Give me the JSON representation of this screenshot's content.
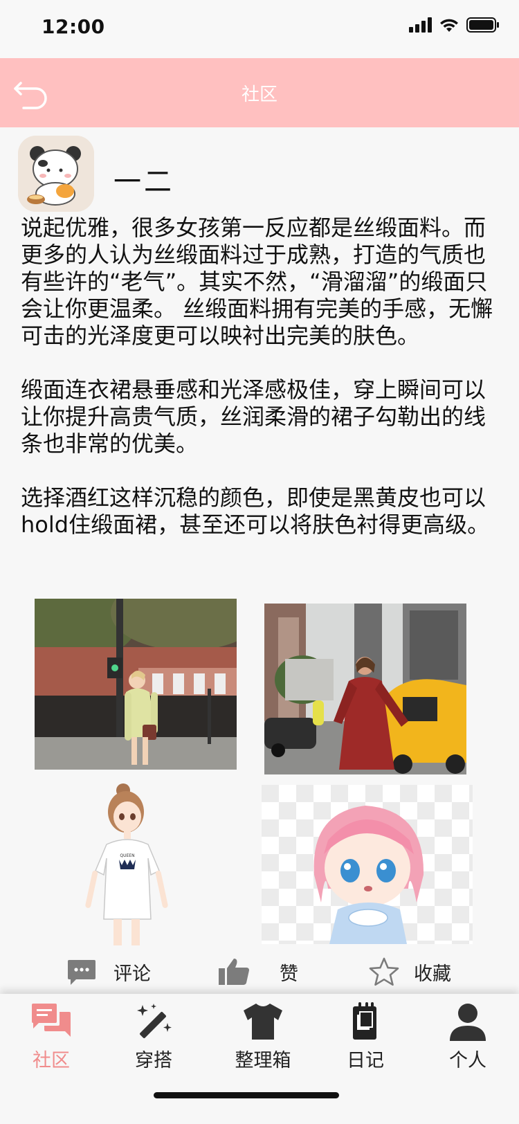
{
  "status_bar": {
    "time": "12:00"
  },
  "nav": {
    "title": "社区"
  },
  "post": {
    "author": "一二",
    "paragraphs": [
      "说起优雅，很多女孩第一反应都是丝缎面料。而更多的人认为丝缎面料过于成熟，打造的气质也有些许的“老气”。其实不然，“滑溜溜”的缎面只会让你更温柔。 丝缎面料拥有完美的手感，无懈可击的光泽度更可以映衬出完美的肤色。",
      "缎面连衣裙悬垂感和光泽感极佳，穿上瞬间可以让你提升高贵气质，丝润柔滑的裙子勾勒出的线条也非常的优美。",
      "选择酒红这样沉稳的颜色，即使是黑黄皮也可以hold住缎面裙，甚至还可以将肤色衬得更高级。"
    ]
  },
  "actions": {
    "comment": "评论",
    "like": "赞",
    "favorite": "收藏"
  },
  "tabs": {
    "community": "社区",
    "outfit": "穿搭",
    "wardrobe": "整理箱",
    "diary": "日记",
    "profile": "个人"
  },
  "colors": {
    "nav_bg": "#ffc0c0",
    "active_tab": "#f08c8c",
    "icon_dark": "#333333"
  }
}
